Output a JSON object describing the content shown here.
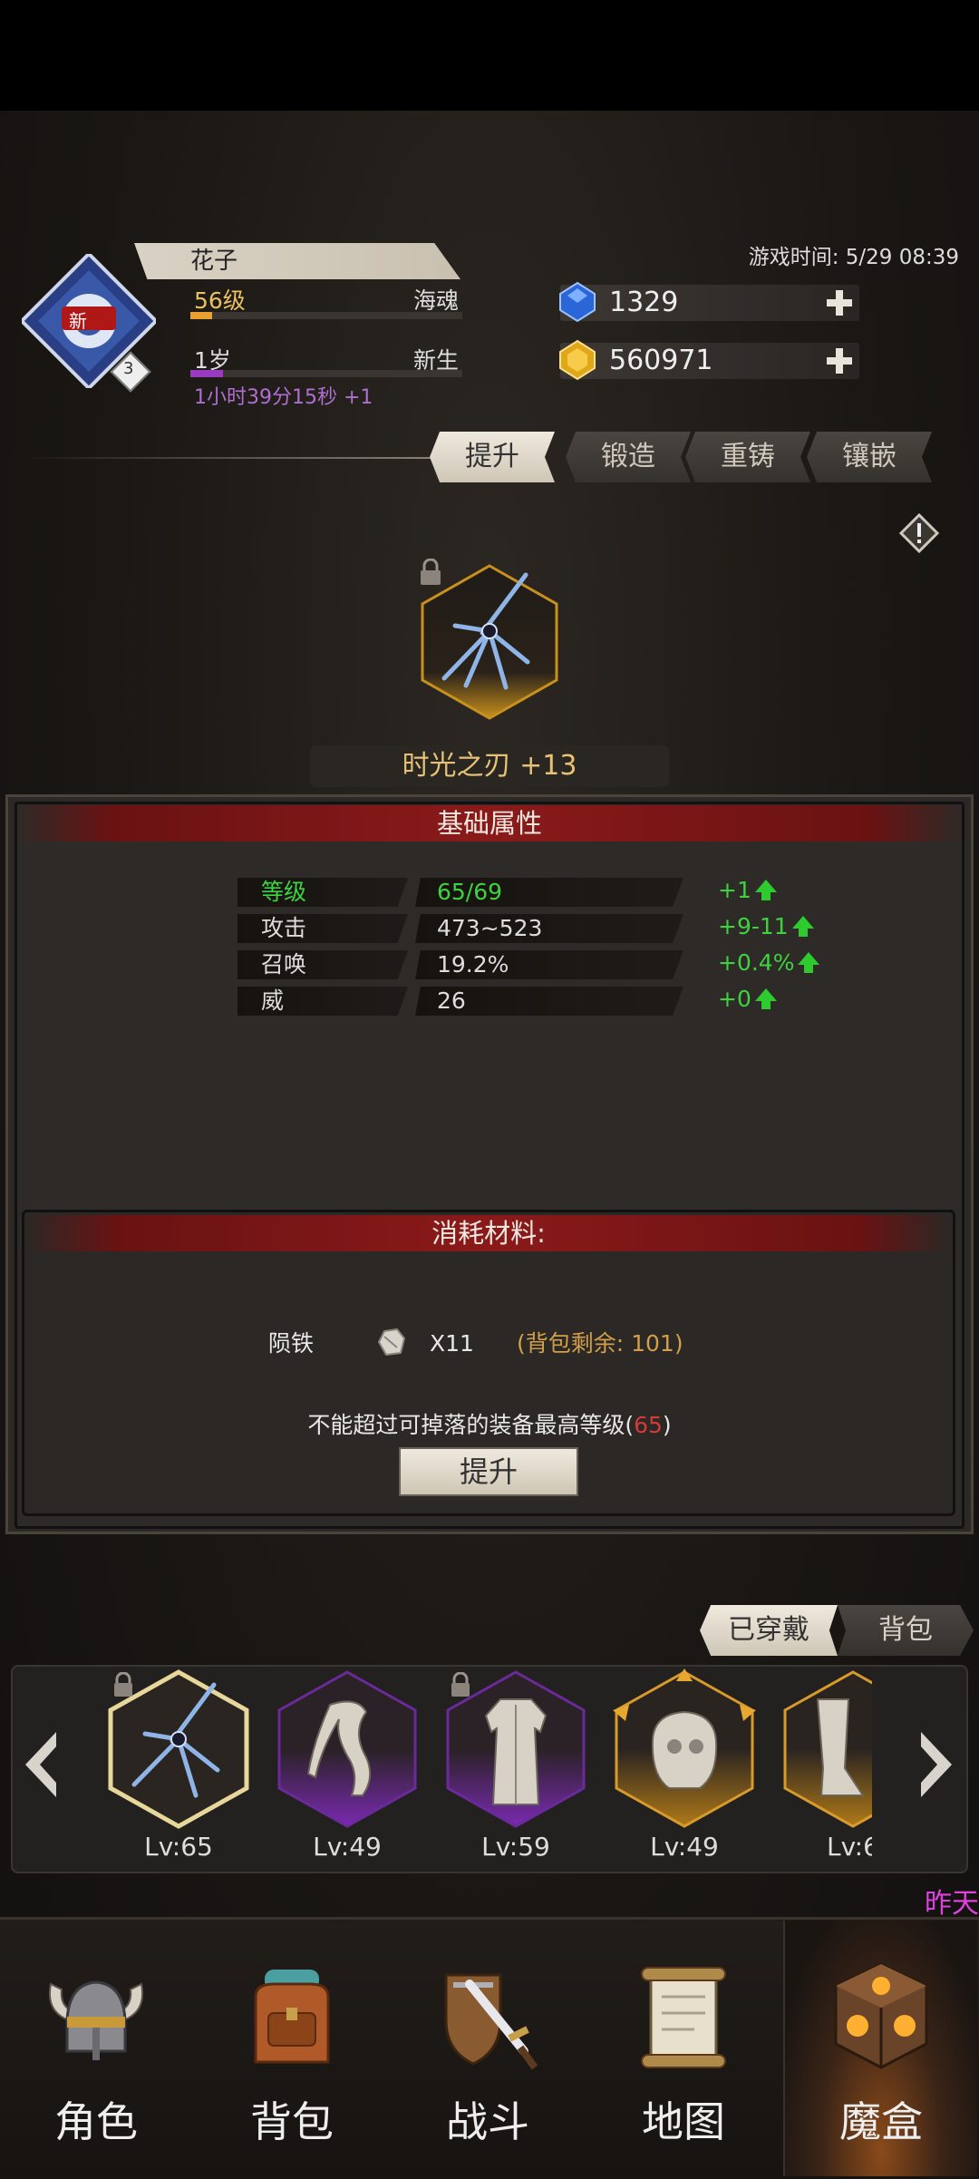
{
  "header": {
    "player_name": "花子",
    "level": "56级",
    "title": "海魂",
    "age": "1岁",
    "age_stage": "新生",
    "timer": "1小时39分15秒 +1",
    "avatar_badge": "新",
    "avatar_count": "3",
    "game_time": "游戏时间: 5/29 08:39",
    "gems": "1329",
    "gold": "560971"
  },
  "tabs": [
    "提升",
    "锻造",
    "重铸",
    "镶嵌"
  ],
  "item": {
    "name": "时光之刃 +13"
  },
  "base_attrs": {
    "title": "基础属性",
    "rows": [
      {
        "key": "等级",
        "value": "65/69",
        "gain": "+1"
      },
      {
        "key": "攻击",
        "value": "473~523",
        "gain": "+9-11"
      },
      {
        "key": "召唤",
        "value": "19.2%",
        "gain": "+0.4%"
      },
      {
        "key": "威",
        "value": "26",
        "gain": "+0"
      }
    ]
  },
  "materials": {
    "title": "消耗材料:",
    "name": "陨铁",
    "qty": "X11",
    "remaining": "(背包剩余: 101)",
    "rule_prefix": "不能超过可掉落的装备最高等级(",
    "rule_level": "65",
    "rule_suffix": ")",
    "button": "提升"
  },
  "equip_tabs": [
    "已穿戴",
    "背包"
  ],
  "equipment": [
    {
      "level": "Lv:65"
    },
    {
      "level": "Lv:49"
    },
    {
      "level": "Lv:59"
    },
    {
      "level": "Lv:49"
    },
    {
      "level": "Lv:6"
    }
  ],
  "yesterday": "昨天",
  "nav": [
    "角色",
    "背包",
    "战斗",
    "地图",
    "魔盒"
  ],
  "colors": {
    "accent_gold": "#e7c275",
    "gain_green": "#3fd13f",
    "red_header": "#8a1a1a",
    "purple": "#b06fd0"
  }
}
